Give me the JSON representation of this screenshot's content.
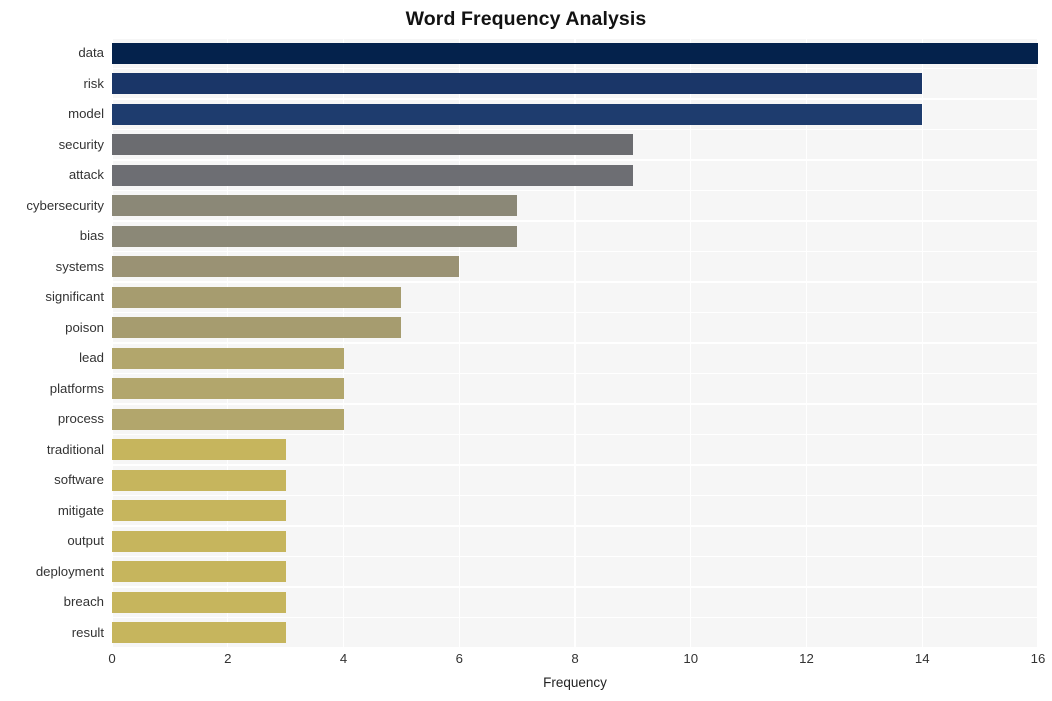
{
  "chart_data": {
    "type": "bar",
    "orientation": "horizontal",
    "title": "Word Frequency Analysis",
    "xlabel": "Frequency",
    "ylabel": "",
    "xlim": [
      0,
      16.0
    ],
    "xticks": [
      0,
      2,
      4,
      6,
      8,
      10,
      12,
      14,
      16
    ],
    "xtick_labels": [
      "0",
      "2",
      "4",
      "6",
      "8",
      "10",
      "12",
      "14",
      "16"
    ],
    "grid": true,
    "legend": false,
    "categories": [
      "data",
      "risk",
      "model",
      "security",
      "attack",
      "cybersecurity",
      "bias",
      "systems",
      "significant",
      "poison",
      "lead",
      "platforms",
      "process",
      "traditional",
      "software",
      "mitigate",
      "output",
      "deployment",
      "breach",
      "result"
    ],
    "values": [
      16,
      14,
      14,
      9,
      9,
      7,
      7,
      6,
      5,
      5,
      4,
      4,
      4,
      3,
      3,
      3,
      3,
      3,
      3,
      3
    ],
    "bar_colors": [
      "#04224c",
      "#1a3668",
      "#1e3c6e",
      "#6b6c70",
      "#6d6e73",
      "#8b8877",
      "#8b8877",
      "#9a9274",
      "#a69c6f",
      "#a69c6f",
      "#b2a66c",
      "#b2a66c",
      "#b2a66c",
      "#c6b55d",
      "#c6b55d",
      "#c6b55d",
      "#c6b55d",
      "#c6b55d",
      "#c6b55d",
      "#c6b55d"
    ],
    "plot_background": "#f6f6f6",
    "figure_background": "#ffffff",
    "gridline_color": "#ffffff"
  }
}
